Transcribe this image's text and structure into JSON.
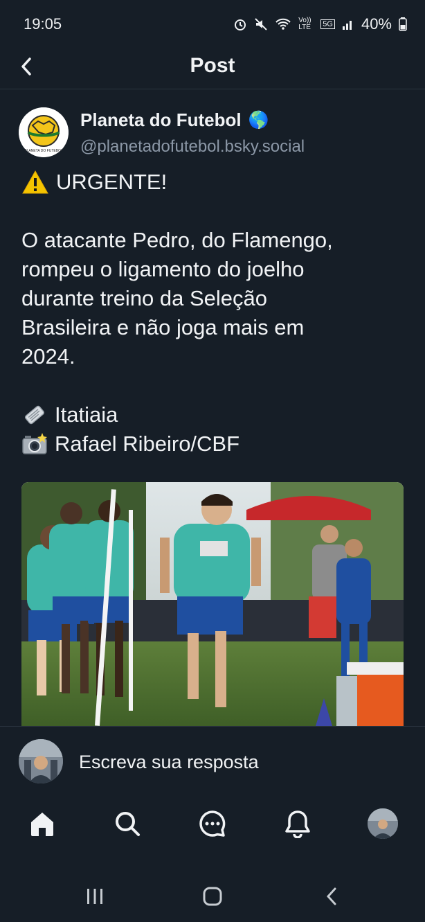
{
  "status_bar": {
    "time": "19:05",
    "battery": "40%",
    "network_lte": "Vo)) LTE",
    "network_5g": "5G"
  },
  "header": {
    "title": "Post"
  },
  "post": {
    "author_name": "Planeta do Futebol",
    "author_handle": "@planetadofutebol.bsky.social",
    "badge_emoji": "🌎",
    "urgent": "URGENTE!",
    "body_lines": [
      "O atacante Pedro, do Flamengo,",
      "rompeu o ligamento do joelho",
      "durante treino da Seleção",
      "Brasileira e não joga mais em",
      "2024."
    ],
    "source_text": "Itatiaia",
    "photo_credit": "Rafael Ribeiro/CBF",
    "logo_text": "PLANETA DO FUTEBOL"
  },
  "reply": {
    "placeholder": "Escreva sua resposta"
  },
  "nav": {
    "items": [
      "home-icon",
      "search-icon",
      "chat-icon",
      "bell-icon",
      "profile-avatar"
    ]
  },
  "colors": {
    "background": "#161e27",
    "divider": "#2b3440",
    "muted_text": "#8c98a7"
  }
}
